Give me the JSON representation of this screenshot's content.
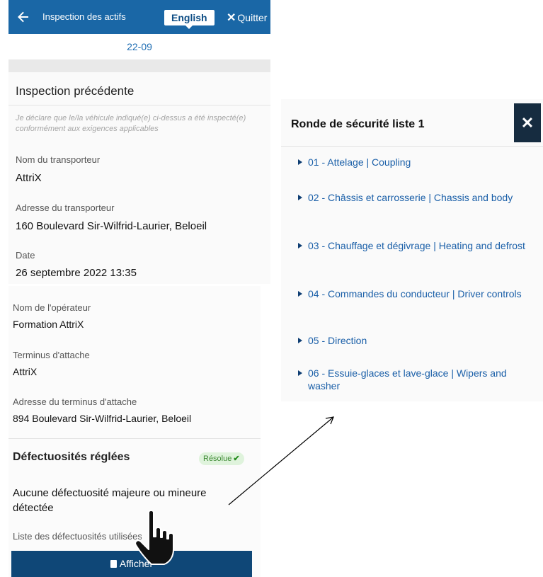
{
  "header": {
    "back_icon": "arrow-left-icon",
    "title": "Inspection des actifs",
    "language_button": "English",
    "quit_label": "Quitter",
    "quit_icon": "close-icon",
    "bar_color": "#1a67a6"
  },
  "subheader": {
    "code": "22-09"
  },
  "inspection": {
    "section_title": "Inspection précédente",
    "declaration": "Je déclare que le/la véhicule indiqué(e) ci-dessus a été inspecté(e) conformément aux exigences applicables",
    "fields": [
      {
        "label": "Nom du transporteur",
        "value": "AttriX"
      },
      {
        "label": "Adresse du transporteur",
        "value": "160 Boulevard Sir-Wilfrid-Laurier, Beloeil"
      },
      {
        "label": "Date",
        "value": "26 septembre 2022 13:35"
      },
      {
        "label": "Nom de l'opérateur",
        "value": "Formation AttriX"
      },
      {
        "label": "Terminus d'attache",
        "value": "AttriX"
      },
      {
        "label": "Adresse du terminus d'attache",
        "value": "894 Boulevard Sir-Wilfrid-Laurier, Beloeil"
      }
    ]
  },
  "defects": {
    "title": "Défectuosités réglées",
    "badge": "Résolue",
    "badge_icon": "check-icon",
    "message": "Aucune défectuosité majeure ou mineure détectée",
    "list_label": "Liste des défectuosités utilisées",
    "show_button": "Afficher",
    "show_icon": "book-icon",
    "button_color": "#0f4777"
  },
  "checklist": {
    "title": "Ronde de sécurité liste 1",
    "close_icon": "close-icon",
    "items": [
      "01 - Attelage | Coupling",
      "02 - Châssis et carrosserie | Chassis and body",
      "03 - Chauffage et dégivrage | Heating and defrost",
      "04 - Commandes du conducteur | Driver controls",
      "05 - Direction",
      "06 - Essuie-glaces et lave-glace | Wipers and washer"
    ],
    "link_color": "#1a5fa8"
  },
  "overlay": {
    "pointer_icon": "hand-pointer-icon",
    "arrow_icon": "arrow-icon"
  }
}
